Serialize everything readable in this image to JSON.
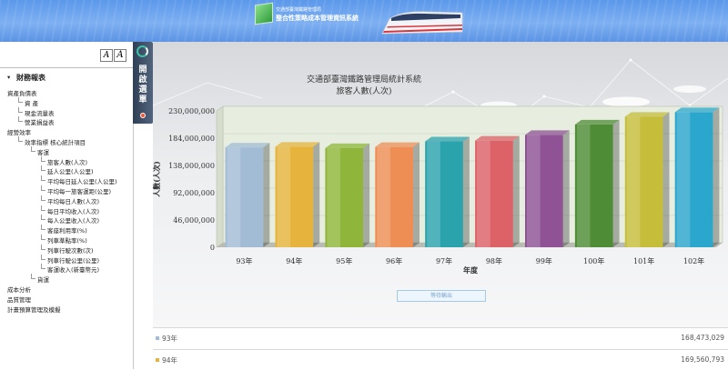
{
  "header": {
    "org_name": "交通部臺灣鐵路管理局",
    "system_name": "整合性策略成本管理資訊系統"
  },
  "menu": {
    "font_small_label": "A",
    "font_large_label": "A",
    "items": [
      {
        "label": "財務報表",
        "level": 0
      },
      {
        "label": "資產負債表",
        "level": 1
      },
      {
        "label": "資 產",
        "level": 2
      },
      {
        "label": "現金流量表",
        "level": 2
      },
      {
        "label": "營業損益表",
        "level": 2
      },
      {
        "label": "經營效率",
        "level": 1
      },
      {
        "label": "效率指標 核心統計項目",
        "level": 2
      },
      {
        "label": "客運",
        "level": 3
      },
      {
        "label": "旅客人數(人次)",
        "level": 4
      },
      {
        "label": "延人公里(人公里)",
        "level": 4
      },
      {
        "label": "平均每日延人公里(人公里)",
        "level": 4
      },
      {
        "label": "平均每一旅客運距(公里)",
        "level": 4
      },
      {
        "label": "平均每日人數(人次)",
        "level": 4
      },
      {
        "label": "每日平均收入(人次)",
        "level": 4
      },
      {
        "label": "每人公里收入(人次)",
        "level": 4
      },
      {
        "label": "客座利用率(%)",
        "level": 4
      },
      {
        "label": "列車準點率(%)",
        "level": 4
      },
      {
        "label": "列車行駛次數(次)",
        "level": 4
      },
      {
        "label": "列車行駛公里(公里)",
        "level": 4
      },
      {
        "label": "客運收入(新臺幣元)",
        "level": 4
      },
      {
        "label": "貨運",
        "level": 3
      },
      {
        "label": "成本分析",
        "level": 1
      },
      {
        "label": "品質管理",
        "level": 1
      },
      {
        "label": "計畫預算管理及模擬",
        "level": 1
      }
    ]
  },
  "open_menu_label": "開啟選單",
  "export_label": "等待輸出",
  "colors": {
    "bars": [
      "#a3bcd6",
      "#e6b43c",
      "#8fb63a",
      "#ee8e55",
      "#2ba3ad",
      "#dc6268",
      "#8e5295",
      "#4e8c35",
      "#c6bd3a",
      "#2ba7cd"
    ]
  },
  "chart_data": {
    "type": "bar",
    "title": "交通部臺灣鐵路管理局統計系統",
    "subtitle": "旅客人數(人次)",
    "xlabel": "年度",
    "ylabel": "人數(人次)",
    "categories": [
      "93年",
      "94年",
      "95年",
      "96年",
      "97年",
      "98年",
      "99年",
      "100年",
      "101年",
      "102年"
    ],
    "values": [
      168473029,
      169560793,
      167400000,
      169200000,
      178600000,
      179900000,
      189500000,
      207100000,
      220300000,
      227800000
    ],
    "y_ticks": [
      "0",
      "46,000,000",
      "92,000,000",
      "138,000,000",
      "184,000,000",
      "230,000,000"
    ],
    "ylim": [
      0,
      230000000
    ],
    "grid": true
  },
  "data_list": [
    {
      "label": "93年",
      "value": "168,473,029",
      "color": "#a3bcd6"
    },
    {
      "label": "94年",
      "value": "169,560,793",
      "color": "#e6b43c"
    }
  ]
}
